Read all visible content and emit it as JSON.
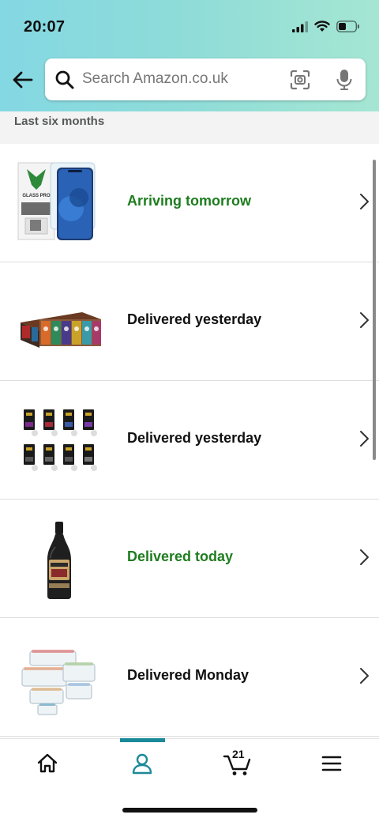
{
  "status_bar": {
    "time": "20:07"
  },
  "search": {
    "placeholder": "Search Amazon.co.uk",
    "value": ""
  },
  "section": {
    "title": "Last six months"
  },
  "orders": [
    {
      "status": "Arriving tomorrow",
      "status_color": "#1e7d1e",
      "icon": "screen-protector-product"
    },
    {
      "status": "Delivered yesterday",
      "status_color": "#111111",
      "icon": "coffee-capsule-boxes-product"
    },
    {
      "status": "Delivered yesterday",
      "status_color": "#111111",
      "icon": "coffee-capsules-product"
    },
    {
      "status": "Delivered today",
      "status_color": "#1e7d1e",
      "icon": "liqueur-bottle-product"
    },
    {
      "status": "Delivered Monday",
      "status_color": "#111111",
      "icon": "food-containers-product"
    }
  ],
  "tabbar": {
    "active_tab": "account",
    "accent_color": "#1b8a98",
    "cart_count": "21",
    "tabs": [
      "home",
      "account",
      "cart",
      "menu"
    ]
  }
}
